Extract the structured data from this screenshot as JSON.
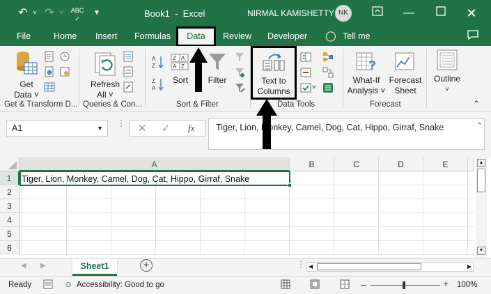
{
  "window": {
    "title": "Book1  -  Excel",
    "user_name": "NIRMAL KAMISHETTY",
    "user_initials": "NK"
  },
  "menu": {
    "tabs": [
      "File",
      "Home",
      "Insert",
      "Formulas",
      "Data",
      "Review",
      "Developer",
      "Tell me"
    ],
    "active": "Data"
  },
  "ribbon": {
    "get_data": {
      "line1": "Get",
      "line2": "Data ˅"
    },
    "refresh_all": {
      "line1": "Refresh",
      "line2": "All ˅"
    },
    "sort": "Sort",
    "filter": "Filter",
    "text_to_columns": {
      "line1": "Text to",
      "line2": "Columns"
    },
    "what_if": {
      "line1": "What-If",
      "line2": "Analysis ˅"
    },
    "forecast_sheet": {
      "line1": "Forecast",
      "line2": "Sheet"
    },
    "outline": "Outline",
    "groups": [
      "Get & Transform D...",
      "Queries & Con...",
      "Sort & Filter",
      "Data Tools",
      "Forecast"
    ]
  },
  "formula_bar": {
    "name_box": "A1",
    "fx": "fx",
    "content": "Tiger, Lion, Monkey, Camel, Dog, Cat, Hippo, Girraf, Snake"
  },
  "sheet": {
    "columns": [
      "A",
      "B",
      "C",
      "D",
      "E"
    ],
    "rows": [
      "1",
      "2",
      "3",
      "4",
      "5",
      "6"
    ],
    "cell_a1": "Tiger, Lion, Monkey, Camel, Dog, Cat, Hippo, Girraf, Snake",
    "tab": "Sheet1"
  },
  "status": {
    "ready": "Ready",
    "accessibility": "Accessibility: Good to go",
    "zoom": "100%"
  },
  "colors": {
    "excel_green": "#217346",
    "ribbon_bg": "#f3f3f3",
    "selection_green": "#217346",
    "annotation": "#000000"
  }
}
